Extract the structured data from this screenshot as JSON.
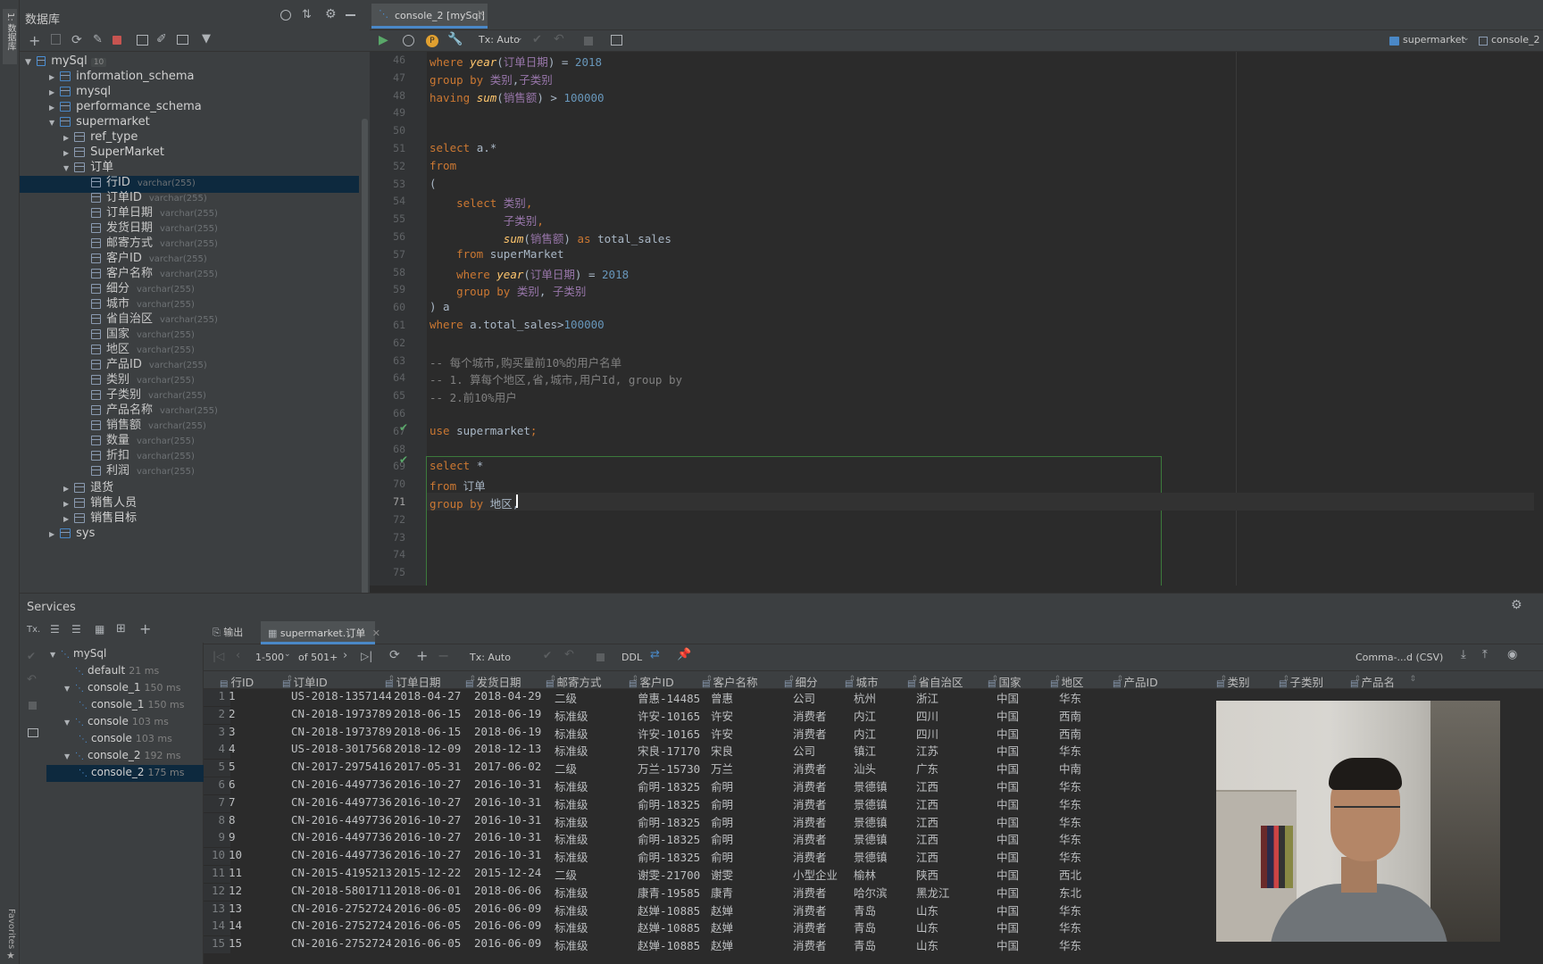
{
  "app": {
    "sidebar_tab": "1: 数据库",
    "favorites_tab": "Favorites"
  },
  "db_panel": {
    "title": "数据库",
    "root": "mySql",
    "root_badge": "10",
    "schemas": [
      "information_schema",
      "mysql",
      "performance_schema",
      "supermarket"
    ],
    "tables": [
      "ref_type",
      "SuperMarket",
      "订单"
    ],
    "columns": [
      {
        "name": "行ID",
        "type": "varchar(255)"
      },
      {
        "name": "订单ID",
        "type": "varchar(255)"
      },
      {
        "name": "订单日期",
        "type": "varchar(255)"
      },
      {
        "name": "发货日期",
        "type": "varchar(255)"
      },
      {
        "name": "邮寄方式",
        "type": "varchar(255)"
      },
      {
        "name": "客户ID",
        "type": "varchar(255)"
      },
      {
        "name": "客户名称",
        "type": "varchar(255)"
      },
      {
        "name": "细分",
        "type": "varchar(255)"
      },
      {
        "name": "城市",
        "type": "varchar(255)"
      },
      {
        "name": "省自治区",
        "type": "varchar(255)"
      },
      {
        "name": "国家",
        "type": "varchar(255)"
      },
      {
        "name": "地区",
        "type": "varchar(255)"
      },
      {
        "name": "产品ID",
        "type": "varchar(255)"
      },
      {
        "name": "类别",
        "type": "varchar(255)"
      },
      {
        "name": "子类别",
        "type": "varchar(255)"
      },
      {
        "name": "产品名称",
        "type": "varchar(255)"
      },
      {
        "name": "销售额",
        "type": "varchar(255)"
      },
      {
        "name": "数量",
        "type": "varchar(255)"
      },
      {
        "name": "折扣",
        "type": "varchar(255)"
      },
      {
        "name": "利润",
        "type": "varchar(255)"
      }
    ],
    "more_tables": [
      "退货",
      "销售人员",
      "销售目标"
    ],
    "last_schema": "sys"
  },
  "editor": {
    "tab": "console_2 [mySql]",
    "tx": "Tx: Auto",
    "schema": "supermarket",
    "console": "console_2",
    "lines": [
      {
        "n": "46",
        "p": [
          [
            "kw",
            "where "
          ],
          [
            "fn",
            "year"
          ],
          [
            "",
            "("
          ],
          [
            "ch",
            "订单日期"
          ],
          [
            "",
            ") = "
          ],
          [
            "num",
            "2018"
          ]
        ]
      },
      {
        "n": "47",
        "p": [
          [
            "kw",
            "group by "
          ],
          [
            "ch",
            "类别"
          ],
          [
            "",
            ","
          ],
          [
            "ch",
            "子类别"
          ]
        ]
      },
      {
        "n": "48",
        "p": [
          [
            "kw",
            "having "
          ],
          [
            "fn",
            "sum"
          ],
          [
            "",
            "("
          ],
          [
            "ch",
            "销售额"
          ],
          [
            "",
            ") > "
          ],
          [
            "num",
            "100000"
          ]
        ]
      },
      {
        "n": "49",
        "p": []
      },
      {
        "n": "50",
        "p": []
      },
      {
        "n": "51",
        "p": [
          [
            "kw",
            "select "
          ],
          [
            "",
            "a.*"
          ]
        ]
      },
      {
        "n": "52",
        "p": [
          [
            "kw",
            "from"
          ]
        ]
      },
      {
        "n": "53",
        "p": [
          [
            "",
            "("
          ]
        ]
      },
      {
        "n": "54",
        "p": [
          [
            "",
            "    "
          ],
          [
            "kw",
            "select "
          ],
          [
            "ch",
            "类别"
          ],
          [
            "kw",
            ","
          ]
        ]
      },
      {
        "n": "55",
        "p": [
          [
            "",
            "           "
          ],
          [
            "ch",
            "子类别"
          ],
          [
            "kw",
            ","
          ]
        ]
      },
      {
        "n": "56",
        "p": [
          [
            "",
            "           "
          ],
          [
            "fn",
            "sum"
          ],
          [
            "",
            "("
          ],
          [
            "ch",
            "销售额"
          ],
          [
            "",
            ") "
          ],
          [
            "kw",
            "as "
          ],
          [
            "",
            "total_sales"
          ]
        ]
      },
      {
        "n": "57",
        "p": [
          [
            "",
            "    "
          ],
          [
            "kw",
            "from "
          ],
          [
            "",
            "superMarket"
          ]
        ]
      },
      {
        "n": "58",
        "p": [
          [
            "",
            "    "
          ],
          [
            "kw",
            "where "
          ],
          [
            "fn",
            "year"
          ],
          [
            "",
            "("
          ],
          [
            "ch",
            "订单日期"
          ],
          [
            "",
            ") = "
          ],
          [
            "num",
            "2018"
          ]
        ]
      },
      {
        "n": "59",
        "p": [
          [
            "",
            "    "
          ],
          [
            "kw",
            "group by "
          ],
          [
            "ch",
            "类别"
          ],
          [
            "",
            ", "
          ],
          [
            "ch",
            "子类别"
          ]
        ]
      },
      {
        "n": "60",
        "p": [
          [
            "",
            ") a"
          ]
        ]
      },
      {
        "n": "61",
        "p": [
          [
            "kw",
            "where "
          ],
          [
            "",
            "a.total_sales>"
          ],
          [
            "num",
            "100000"
          ]
        ]
      },
      {
        "n": "62",
        "p": []
      },
      {
        "n": "63",
        "p": [
          [
            "cm",
            "-- 每个城市,购买量前10%的用户名单"
          ]
        ]
      },
      {
        "n": "64",
        "p": [
          [
            "cm",
            "-- 1. 算每个地区,省,城市,用户Id, group by"
          ]
        ]
      },
      {
        "n": "65",
        "p": [
          [
            "cm",
            "-- 2.前10%用户"
          ]
        ]
      },
      {
        "n": "66",
        "p": []
      },
      {
        "n": "67",
        "p": [
          [
            "kw",
            "use "
          ],
          [
            "",
            "supermarket"
          ],
          [
            "kw",
            ";"
          ]
        ]
      },
      {
        "n": "68",
        "p": []
      },
      {
        "n": "69",
        "p": [
          [
            "kw",
            "select "
          ],
          [
            "",
            "*"
          ]
        ]
      },
      {
        "n": "70",
        "p": [
          [
            "kw",
            "from "
          ],
          [
            "",
            "订单"
          ]
        ]
      },
      {
        "n": "71",
        "p": [
          [
            "kw",
            "group by "
          ],
          [
            "",
            "地区,"
          ]
        ]
      },
      {
        "n": "72",
        "p": []
      },
      {
        "n": "73",
        "p": []
      },
      {
        "n": "74",
        "p": []
      },
      {
        "n": "75",
        "p": []
      }
    ]
  },
  "services": {
    "title": "Services",
    "tree": [
      {
        "label": "mySql",
        "time": "",
        "lvl": 0
      },
      {
        "label": "default",
        "time": "21 ms",
        "lvl": 1
      },
      {
        "label": "console_1",
        "time": "150 ms",
        "lvl": 1
      },
      {
        "label": "console_1",
        "time": "150 ms",
        "lvl": 2
      },
      {
        "label": "console",
        "time": "103 ms",
        "lvl": 1
      },
      {
        "label": "console",
        "time": "103 ms",
        "lvl": 2
      },
      {
        "label": "console_2",
        "time": "192 ms",
        "lvl": 1
      },
      {
        "label": "console_2",
        "time": "175 ms",
        "lvl": 2
      }
    ]
  },
  "results": {
    "tab_output": "输出",
    "tab_table": "supermarket.订单",
    "range": "1-500",
    "of": "of 501+",
    "tx": "Tx: Auto",
    "ddl": "DDL",
    "export": "Comma-...d (CSV)",
    "columns": [
      "行ID",
      "订单ID",
      "订单日期",
      "发货日期",
      "邮寄方式",
      "客户ID",
      "客户名称",
      "细分",
      "城市",
      "省自治区",
      "国家",
      "地区",
      "产品ID",
      "类别",
      "子类别",
      "产品名"
    ],
    "rows": [
      [
        "1",
        "US-2018-1357144",
        "2018-04-27",
        "2018-04-29",
        "二级",
        "曾惠-14485",
        "曾惠",
        "公司",
        "杭州",
        "浙江",
        "中国",
        "华东"
      ],
      [
        "2",
        "CN-2018-1973789",
        "2018-06-15",
        "2018-06-19",
        "标准级",
        "许安-10165",
        "许安",
        "消费者",
        "内江",
        "四川",
        "中国",
        "西南"
      ],
      [
        "3",
        "CN-2018-1973789",
        "2018-06-15",
        "2018-06-19",
        "标准级",
        "许安-10165",
        "许安",
        "消费者",
        "内江",
        "四川",
        "中国",
        "西南"
      ],
      [
        "4",
        "US-2018-3017568",
        "2018-12-09",
        "2018-12-13",
        "标准级",
        "宋良-17170",
        "宋良",
        "公司",
        "镇江",
        "江苏",
        "中国",
        "华东"
      ],
      [
        "5",
        "CN-2017-2975416",
        "2017-05-31",
        "2017-06-02",
        "二级",
        "万兰-15730",
        "万兰",
        "消费者",
        "汕头",
        "广东",
        "中国",
        "中南"
      ],
      [
        "6",
        "CN-2016-4497736",
        "2016-10-27",
        "2016-10-31",
        "标准级",
        "俞明-18325",
        "俞明",
        "消费者",
        "景德镇",
        "江西",
        "中国",
        "华东"
      ],
      [
        "7",
        "CN-2016-4497736",
        "2016-10-27",
        "2016-10-31",
        "标准级",
        "俞明-18325",
        "俞明",
        "消费者",
        "景德镇",
        "江西",
        "中国",
        "华东"
      ],
      [
        "8",
        "CN-2016-4497736",
        "2016-10-27",
        "2016-10-31",
        "标准级",
        "俞明-18325",
        "俞明",
        "消费者",
        "景德镇",
        "江西",
        "中国",
        "华东"
      ],
      [
        "9",
        "CN-2016-4497736",
        "2016-10-27",
        "2016-10-31",
        "标准级",
        "俞明-18325",
        "俞明",
        "消费者",
        "景德镇",
        "江西",
        "中国",
        "华东"
      ],
      [
        "10",
        "CN-2016-4497736",
        "2016-10-27",
        "2016-10-31",
        "标准级",
        "俞明-18325",
        "俞明",
        "消费者",
        "景德镇",
        "江西",
        "中国",
        "华东"
      ],
      [
        "11",
        "CN-2015-4195213",
        "2015-12-22",
        "2015-12-24",
        "二级",
        "谢雯-21700",
        "谢雯",
        "小型企业",
        "榆林",
        "陕西",
        "中国",
        "西北"
      ],
      [
        "12",
        "CN-2018-5801711",
        "2018-06-01",
        "2018-06-06",
        "标准级",
        "康青-19585",
        "康青",
        "消费者",
        "哈尔滨",
        "黑龙江",
        "中国",
        "东北"
      ],
      [
        "13",
        "CN-2016-2752724",
        "2016-06-05",
        "2016-06-09",
        "标准级",
        "赵婵-10885",
        "赵婵",
        "消费者",
        "青岛",
        "山东",
        "中国",
        "华东"
      ],
      [
        "14",
        "CN-2016-2752724",
        "2016-06-05",
        "2016-06-09",
        "标准级",
        "赵婵-10885",
        "赵婵",
        "消费者",
        "青岛",
        "山东",
        "中国",
        "华东"
      ],
      [
        "15",
        "CN-2016-2752724",
        "2016-06-05",
        "2016-06-09",
        "标准级",
        "赵婵-10885",
        "赵婵",
        "消费者",
        "青岛",
        "山东",
        "中国",
        "华东"
      ]
    ]
  }
}
